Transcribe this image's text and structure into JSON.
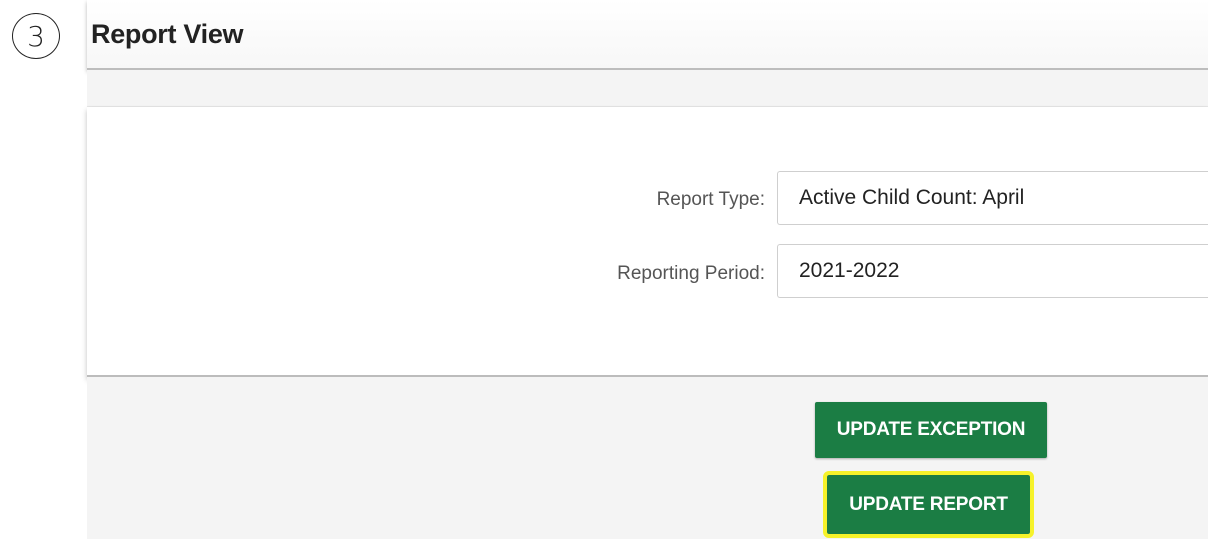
{
  "step_badge": "3",
  "header": {
    "title": "Report View"
  },
  "form": {
    "report_type": {
      "label": "Report Type:",
      "value": "Active Child Count: April"
    },
    "reporting_period": {
      "label": "Reporting Period:",
      "value": "2021-2022"
    }
  },
  "actions": {
    "update_exception_label": "UPDATE EXCEPTION",
    "update_report_label": "UPDATE REPORT",
    "highlight_color": "#f6f22a",
    "button_color": "#1b7d44"
  }
}
